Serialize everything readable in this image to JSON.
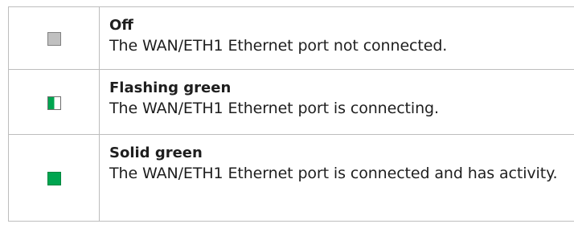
{
  "rows": [
    {
      "status": "Off",
      "description": "The WAN/ETH1 Ethernet port not connected.",
      "led_icon": "led-off-icon",
      "led_color": "#c0c0c0"
    },
    {
      "status": "Flashing green",
      "description": "The WAN/ETH1 Ethernet port is connecting.",
      "led_icon": "led-flashing-green-icon",
      "led_color": "#00a550"
    },
    {
      "status": "Solid green",
      "description": "The WAN/ETH1 Ethernet port is connected and has activity.",
      "led_icon": "led-solid-green-icon",
      "led_color": "#00a550"
    }
  ],
  "colors": {
    "border": "#bdbdbd",
    "text": "#1e1e1e",
    "green": "#00a550",
    "grey": "#c0c0c0"
  }
}
